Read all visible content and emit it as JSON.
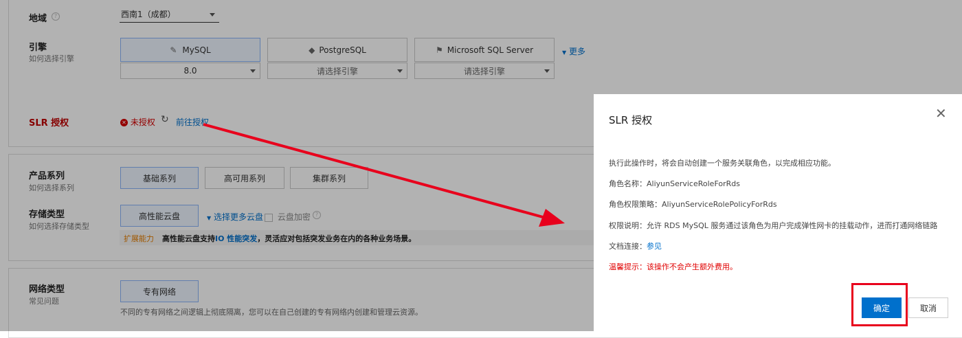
{
  "form": {
    "region": {
      "label": "地域",
      "value": "西南1（成都）"
    },
    "engine": {
      "label": "引擎",
      "help": "如何选择引擎",
      "options": [
        {
          "name": "MySQL",
          "version": "8.0",
          "selected": true
        },
        {
          "name": "PostgreSQL",
          "version": "请选择引擎",
          "selected": false
        },
        {
          "name": "Microsoft SQL Server",
          "version": "请选择引擎",
          "selected": false
        }
      ],
      "more": "更多"
    },
    "slr": {
      "label": "SLR 授权",
      "status": "未授权",
      "action": "前往授权"
    },
    "series": {
      "label": "产品系列",
      "help": "如何选择系列",
      "options": [
        "基础系列",
        "高可用系列",
        "集群系列"
      ],
      "selected_index": 0
    },
    "storage": {
      "label": "存储类型",
      "help": "如何选择存储类型",
      "option": "高性能云盘",
      "more": "选择更多云盘",
      "encrypt": "云盘加密",
      "tip_tag": "扩展能力",
      "tip_text_a": "高性能云盘支持",
      "tip_link": "IO 性能突发",
      "tip_text_b": "，灵活应对包括突发业务在内的各种业务场景。"
    },
    "network": {
      "label": "网络类型",
      "help": "常见问题",
      "option": "专有网络",
      "desc": "不同的专有网络之间逻辑上彻底隔离，您可以在自己创建的专有网络内创建和管理云资源。"
    }
  },
  "modal": {
    "title": "SLR 授权",
    "intro": "执行此操作时，将会自动创建一个服务关联角色，以完成相应功能。",
    "role_name_label": "角色名称：",
    "role_name": "AliyunServiceRoleForRds",
    "role_policy_label": "角色权限策略：",
    "role_policy": "AliyunServiceRolePolicyForRds",
    "perm_label": "权限说明：",
    "perm_text": "允许 RDS MySQL 服务通过该角色为用户完成弹性网卡的挂载动作，进而打通网络链路",
    "doc_label": "文档连接：",
    "doc_link": "参见",
    "warning": "温馨提示：该操作不会产生额外费用。",
    "confirm": "确定",
    "cancel": "取消"
  },
  "colors": {
    "accent": "#0070cc",
    "danger": "#d40000",
    "annotation": "#e8001c"
  }
}
